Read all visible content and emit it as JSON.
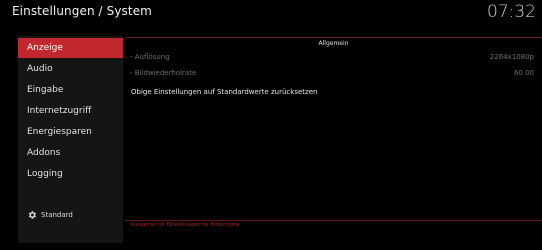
{
  "header": {
    "title": "Einstellungen / System",
    "clock": "07:32"
  },
  "sidebar": {
    "items": [
      {
        "label": "Anzeige",
        "active": true
      },
      {
        "label": "Audio",
        "active": false
      },
      {
        "label": "Eingabe",
        "active": false
      },
      {
        "label": "Internetzugriff",
        "active": false
      },
      {
        "label": "Energiesparen",
        "active": false
      },
      {
        "label": "Addons",
        "active": false
      },
      {
        "label": "Logging",
        "active": false
      }
    ],
    "level_label": "Standard",
    "level_icon": "gear-icon"
  },
  "content": {
    "section_title": "Allgemein",
    "settings": [
      {
        "label": "- Auflösung",
        "value": "2264x1080p"
      },
      {
        "label": "- Bildwiederholrate",
        "value": "60.00"
      }
    ],
    "reset_label": "Obige Einstellungen auf Standardwerte zurücksetzen"
  },
  "footer": {
    "text": "Kategorie mit Einstellungen für Bildschirme"
  },
  "colors": {
    "accent": "#c1272d",
    "sidebar_bg": "#151515",
    "background": "#000000"
  }
}
